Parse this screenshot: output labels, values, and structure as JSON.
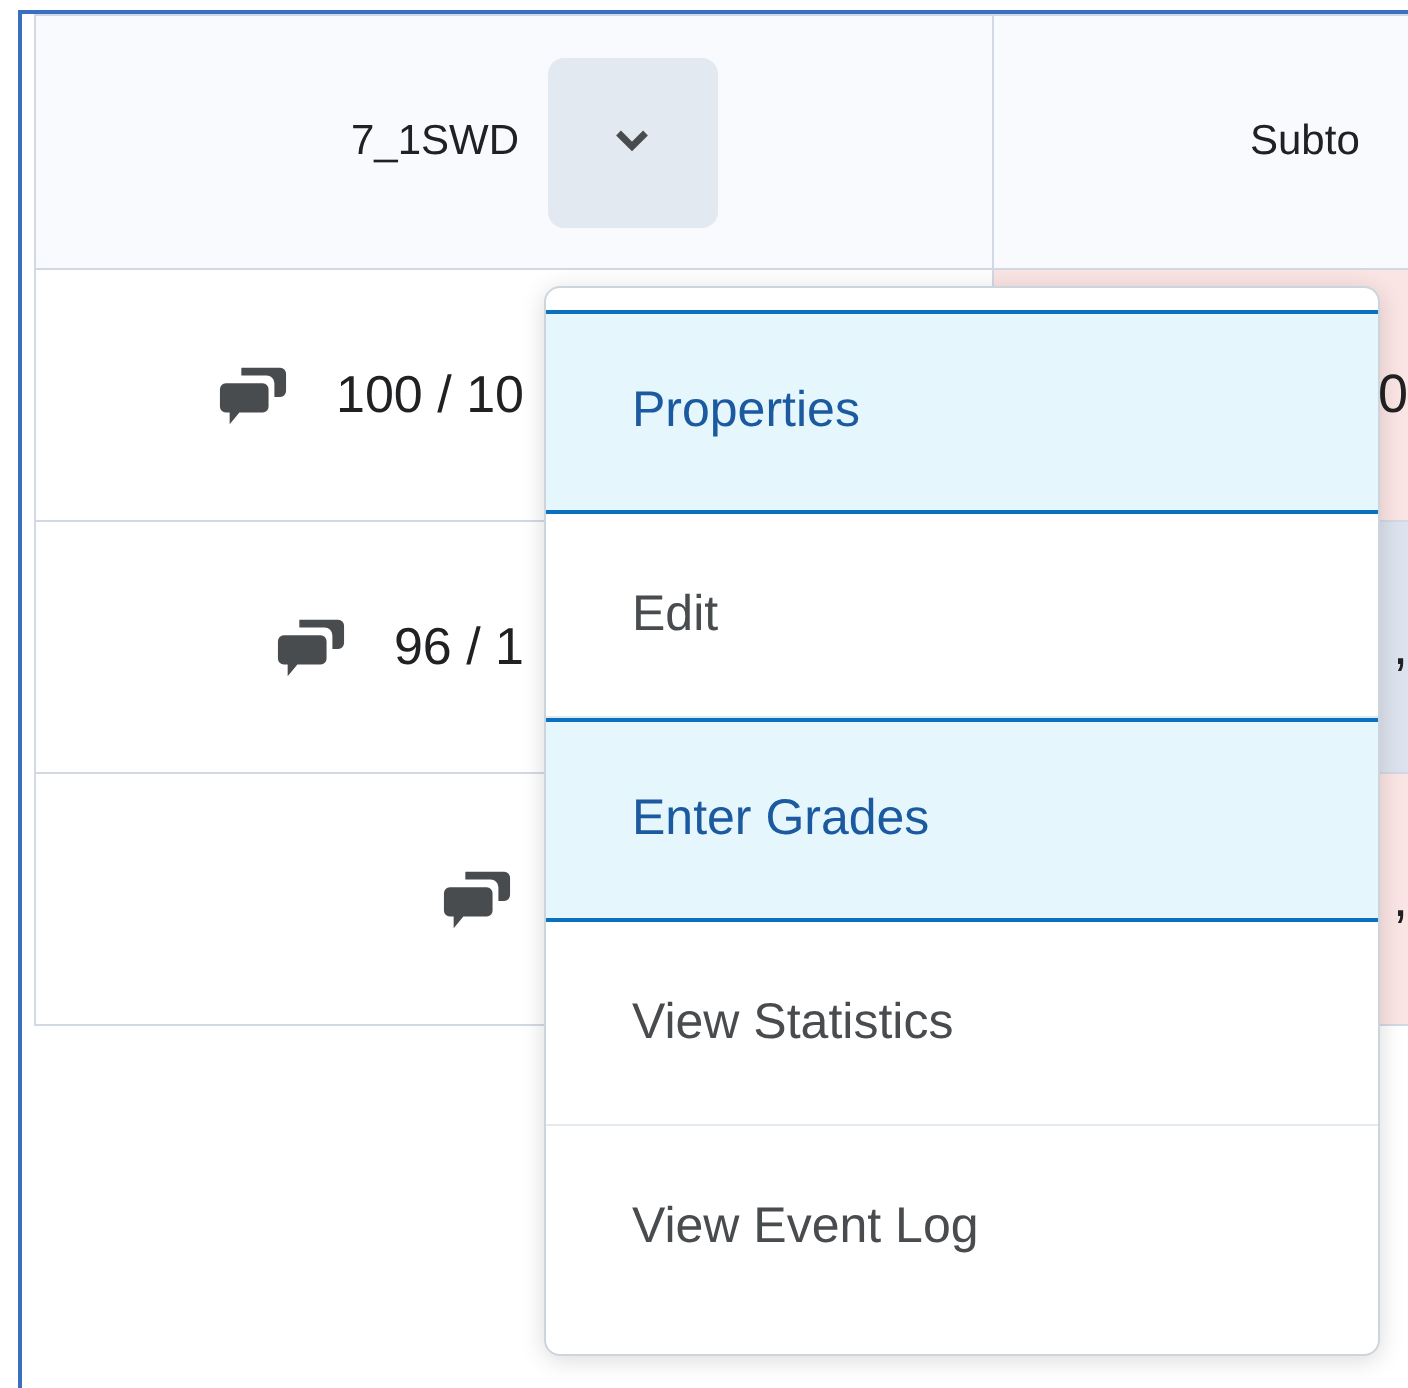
{
  "table": {
    "columns": [
      {
        "label": "7_1SWD",
        "has_menu": true
      },
      {
        "label": "Subto",
        "has_menu": false
      }
    ],
    "rows": [
      {
        "grade": "100 / 10",
        "column_2": "0",
        "color": "#fbe4e4"
      },
      {
        "grade": "96 / 1",
        "column_2": ",",
        "color": "#dde3ee"
      },
      {
        "column_2": ",",
        "color": "#fbe4e4"
      }
    ]
  },
  "menu": {
    "items": [
      {
        "label": "Properties",
        "highlighted": true
      },
      {
        "label": "Edit",
        "highlighted": false
      },
      {
        "label": "Enter Grades",
        "highlighted": true
      },
      {
        "label": "View Statistics",
        "highlighted": false
      },
      {
        "label": "View Event Log",
        "highlighted": false
      }
    ]
  }
}
